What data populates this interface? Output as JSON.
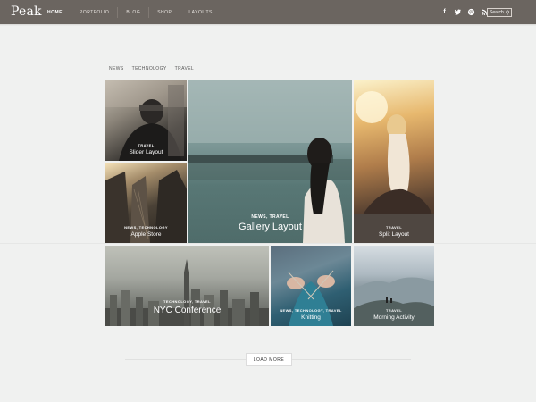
{
  "header": {
    "logo": "Peak",
    "nav": [
      "HOME",
      "PORTFOLIO",
      "BLOG",
      "SHOP",
      "LAYOUTS"
    ],
    "social": [
      {
        "icon": "facebook-icon",
        "glyph": "f"
      },
      {
        "icon": "twitter-icon",
        "glyph": "t"
      },
      {
        "icon": "pinterest-icon",
        "glyph": "p"
      },
      {
        "icon": "rss-icon",
        "glyph": "r"
      }
    ],
    "search_label": "Search"
  },
  "filters": [
    "NEWS",
    "TECHNOLOGY",
    "TRAVEL"
  ],
  "tiles": [
    {
      "category": "TRAVEL",
      "title": "Slider Layout"
    },
    {
      "category": "NEWS, TECHNOLOGY",
      "title": "Apple Store"
    },
    {
      "category": "NEWS, TRAVEL",
      "title": "Gallery Layout"
    },
    {
      "category": "TRAVEL",
      "title": "Split Layout"
    },
    {
      "category": "TECHNOLOGY, TRAVEL",
      "title": "NYC Conference"
    },
    {
      "category": "NEWS, TECHNOLOGY, TRAVEL",
      "title": "Knitting"
    },
    {
      "category": "TRAVEL",
      "title": "Morning Activity"
    }
  ],
  "load_more": "LOAD MORE",
  "colors": {
    "header_bg": "#6b6560",
    "page_bg": "#f0f1f0"
  }
}
